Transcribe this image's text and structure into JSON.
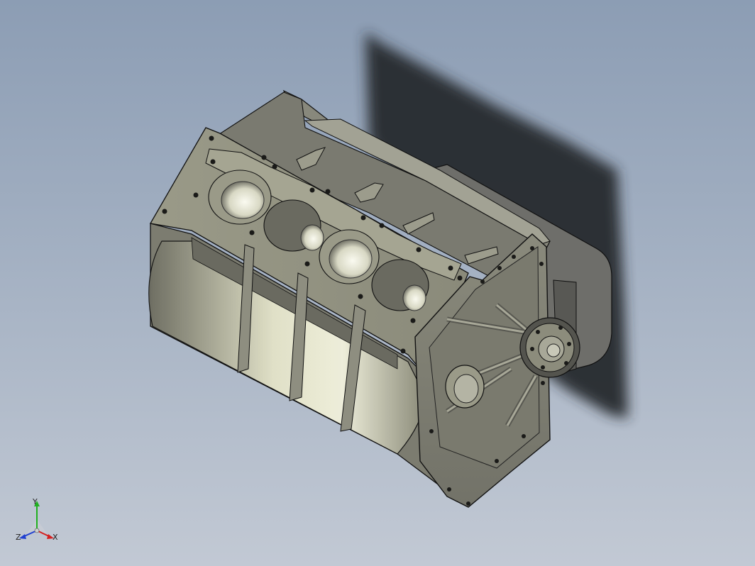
{
  "viewport": {
    "background_top": "#8c9db4",
    "background_bottom": "#c2c9d4",
    "model": "engine-block",
    "shadow_color": "#2a2d31"
  },
  "triad": {
    "x_label": "X",
    "y_label": "Y",
    "z_label": "Z",
    "x_color": "#d42020",
    "y_color": "#20b020",
    "z_color": "#2040d0"
  }
}
